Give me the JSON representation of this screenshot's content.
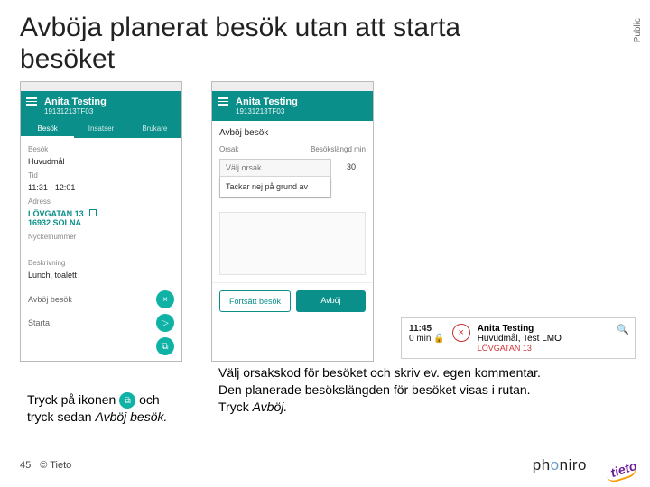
{
  "classification": "Public",
  "title": "Avböja planerat besök utan att starta besöket",
  "phone1": {
    "appbar_title": "Anita Testing",
    "appbar_sub": "19131213TF03",
    "tabs": {
      "t1": "Besök",
      "t2": "Insatser",
      "t3": "Brukare"
    },
    "section_besok": "Besök",
    "besok_val": "Huvudmål",
    "section_tid": "Tid",
    "tid_val": "11:31 - 12:01",
    "section_adress": "Adress",
    "adress_line1": "LÖVGATAN 13",
    "adress_line2": "16932 SOLNA",
    "section_nyckel": "Nyckelnummer",
    "section_beskr": "Beskrivning",
    "beskr_val": "Lunch, toalett",
    "action_avboj": "Avböj besök",
    "action_starta": "Starta"
  },
  "phone2": {
    "appbar_title": "Anita Testing",
    "appbar_sub": "19131213TF03",
    "heading": "Avböj besök",
    "col_orsak": "Orsak",
    "col_length": "Besökslängd min",
    "length_val": "30",
    "dd_placeholder": "Välj orsak",
    "dd_option": "Tackar nej på grund av",
    "btn_back": "Fortsätt besök",
    "btn_reject": "Avböj"
  },
  "card": {
    "time": "11:45",
    "sub": "0 min",
    "name": "Anita Testing",
    "line2": "Huvudmål, Test LMO",
    "addr": "LÖVGATAN 13"
  },
  "cap_left": {
    "l1a": "Tryck på ikonen ",
    "l1b": " och",
    "l2a": "tryck sedan ",
    "l2b": "Avböj besök."
  },
  "cap_right": {
    "l1": "Välj orsakskod för besöket och skriv ev. egen kommentar.",
    "l2": "Den planerade besökslängden för besöket visas i rutan.",
    "l3a": "Tryck ",
    "l3b": "Avböj."
  },
  "footer": {
    "page": "45",
    "copyright": "© Tieto"
  }
}
